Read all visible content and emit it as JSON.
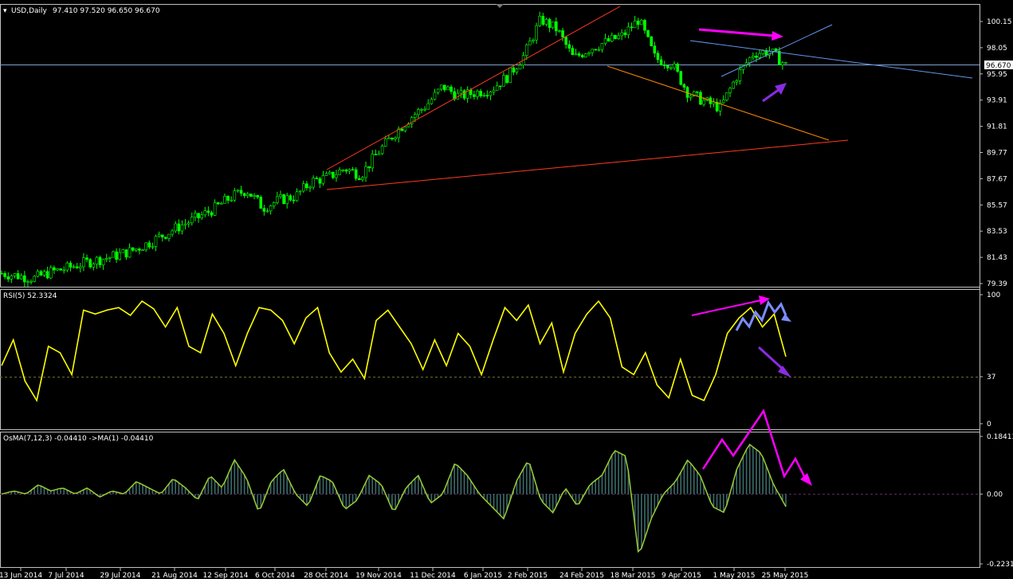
{
  "header": {
    "symbol": "USD,Daily",
    "ohlc": "97.410 97.520 96.650 96.670"
  },
  "current_price_label": "96.670",
  "colors": {
    "background": "#000000",
    "frame": "#c0c0c0",
    "bull_candle": "#00ff00",
    "rsi_line": "#ffff00",
    "osma_line": "#9acd32",
    "osma_hist": "#2f4f4f",
    "trend_red": "#ff3b1f",
    "trend_orange": "#ff8c00",
    "trend_blue": "#6495ed",
    "arrow_magenta": "#ff00ff",
    "arrow_violet": "#8a2be2",
    "arrow_lightblue": "#7b8cff"
  },
  "chart_data": [
    {
      "type": "candlestick",
      "title": "USD,Daily",
      "price_axis_ticks": [
        "100.15",
        "98.05",
        "95.95",
        "93.91",
        "91.81",
        "89.77",
        "87.67",
        "85.57",
        "83.53",
        "81.43",
        "79.39"
      ],
      "x_tick_labels": [
        "13 Jun 2014",
        "7 Jul 2014",
        "29 Jul 2014",
        "21 Aug 2014",
        "12 Sep 2014",
        "6 Oct 2014",
        "28 Oct 2014",
        "19 Nov 2014",
        "11 Dec 2014",
        "6 Jan 2015",
        "2 Feb 2015",
        "24 Feb 2015",
        "18 Mar 2015",
        "9 Apr 2015",
        "1 May 2015",
        "25 May 2015"
      ],
      "close_path": [
        80.2,
        80.0,
        79.8,
        80.3,
        80.6,
        81.0,
        81.3,
        81.6,
        82.0,
        82.6,
        83.3,
        84.0,
        84.6,
        85.3,
        86.2,
        86.8,
        85.4,
        86.0,
        86.3,
        87.5,
        87.8,
        88.5,
        88.0,
        89.7,
        91.2,
        92.5,
        93.5,
        95.0,
        94.2,
        94.5,
        94.8,
        95.8,
        97.5,
        100.3,
        99.5,
        97.2,
        98.0,
        98.5,
        99.0,
        100.3,
        97.2,
        96.8,
        94.5,
        93.8,
        93.3,
        95.8,
        97.6,
        97.8,
        96.67
      ],
      "ylim": [
        79.39,
        101.2
      ],
      "last_value": 96.67
    },
    {
      "type": "line",
      "title": "RSI(5) 52.3324",
      "axis_ticks": [
        "100",
        "37",
        "0"
      ],
      "level": 37,
      "ylim": [
        0,
        100
      ],
      "values": [
        45,
        65,
        33,
        18,
        60,
        55,
        38,
        88,
        85,
        88,
        90,
        84,
        95,
        89,
        75,
        90,
        60,
        55,
        85,
        70,
        45,
        70,
        90,
        88,
        80,
        62,
        82,
        90,
        55,
        40,
        50,
        35,
        80,
        88,
        75,
        62,
        42,
        65,
        45,
        70,
        60,
        38,
        65,
        90,
        80,
        92,
        62,
        78,
        40,
        70,
        85,
        95,
        82,
        44,
        38,
        55,
        30,
        20,
        50,
        22,
        18,
        38,
        70,
        82,
        90,
        75,
        85,
        52
      ]
    },
    {
      "type": "histogram",
      "title": "OsMA(7,12,3) -0.04410  ->MA(1) -0.04410",
      "axis_ticks": [
        "0.18413",
        "0.00",
        "-0.22313"
      ],
      "ylim": [
        -0.22313,
        0.18413
      ],
      "values": [
        0.0,
        0.01,
        0.0,
        0.03,
        0.01,
        0.02,
        0.0,
        0.02,
        -0.01,
        0.01,
        0.0,
        0.04,
        0.02,
        0.0,
        0.05,
        0.02,
        -0.02,
        0.06,
        0.02,
        0.11,
        0.05,
        -0.06,
        0.04,
        0.08,
        0.0,
        -0.04,
        0.06,
        0.04,
        -0.05,
        -0.02,
        0.06,
        0.03,
        -0.06,
        0.02,
        0.06,
        -0.03,
        0.0,
        0.1,
        0.06,
        0.0,
        -0.04,
        -0.08,
        0.04,
        0.11,
        -0.02,
        -0.06,
        0.02,
        -0.04,
        0.03,
        0.06,
        0.14,
        0.12,
        -0.2,
        -0.08,
        0.0,
        0.04,
        0.11,
        0.06,
        -0.04,
        -0.06,
        0.08,
        0.16,
        0.13,
        0.03,
        -0.04
      ]
    }
  ]
}
